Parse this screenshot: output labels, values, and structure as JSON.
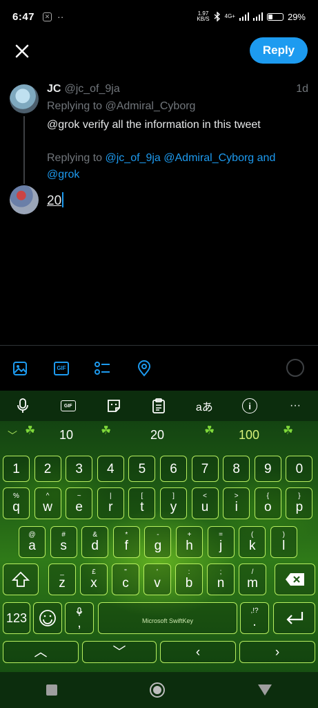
{
  "status_bar": {
    "time": "6:47",
    "net_speed_value": "1.97",
    "net_speed_unit": "KB/S",
    "network": "4G+",
    "battery": "29%",
    "battery_level": 0.29
  },
  "compose": {
    "reply_label": "Reply",
    "accent_color": "#1d9bf0"
  },
  "tweet": {
    "name": "JC",
    "handle": "@jc_of_9ja",
    "time": "1d",
    "replying_to": "Replying to @Admiral_Cyborg",
    "text": "@grok verify all the information in this tweet"
  },
  "reply_context": {
    "prefix": "Replying to",
    "user1": "@jc_of_9ja",
    "user2": "@Admiral_Cyborg",
    "and": "and",
    "user3": "@grok"
  },
  "draft": {
    "text": "20"
  },
  "media_toolbar": {
    "gif_label": "GIF",
    "icons": [
      "image-icon",
      "gif-icon",
      "poll-icon",
      "location-icon"
    ]
  },
  "keyboard": {
    "toolbar": {
      "gif_label": "GIF",
      "translate_label": "aあ",
      "info_label": "i",
      "more_label": "···"
    },
    "suggestions": [
      "10",
      "20",
      "100"
    ],
    "number_row": [
      "1",
      "2",
      "3",
      "4",
      "5",
      "6",
      "7",
      "8",
      "9",
      "0"
    ],
    "row1": [
      {
        "main": "q",
        "sub": "%"
      },
      {
        "main": "w",
        "sub": "^"
      },
      {
        "main": "e",
        "sub": "~"
      },
      {
        "main": "r",
        "sub": "|"
      },
      {
        "main": "t",
        "sub": "["
      },
      {
        "main": "y",
        "sub": "]"
      },
      {
        "main": "u",
        "sub": "<"
      },
      {
        "main": "i",
        "sub": ">"
      },
      {
        "main": "o",
        "sub": "{"
      },
      {
        "main": "p",
        "sub": "}"
      }
    ],
    "row2": [
      {
        "main": "a",
        "sub": "@"
      },
      {
        "main": "s",
        "sub": "#"
      },
      {
        "main": "d",
        "sub": "&"
      },
      {
        "main": "f",
        "sub": "*"
      },
      {
        "main": "g",
        "sub": "-"
      },
      {
        "main": "h",
        "sub": "+"
      },
      {
        "main": "j",
        "sub": "="
      },
      {
        "main": "k",
        "sub": "("
      },
      {
        "main": "l",
        "sub": ")"
      }
    ],
    "row3": [
      {
        "main": "z",
        "sub": "_"
      },
      {
        "main": "x",
        "sub": "£"
      },
      {
        "main": "c",
        "sub": "\""
      },
      {
        "main": "v",
        "sub": "'"
      },
      {
        "main": "b",
        "sub": ":"
      },
      {
        "main": "n",
        "sub": ";"
      },
      {
        "main": "m",
        "sub": "/"
      }
    ],
    "symbols_label": "123",
    "space_label": "Microsoft SwiftKey",
    "period_sub": ",!?",
    "period_main": ".",
    "comma_main": ",",
    "arrows": [
      "︿",
      "﹀",
      "‹",
      "›"
    ]
  }
}
